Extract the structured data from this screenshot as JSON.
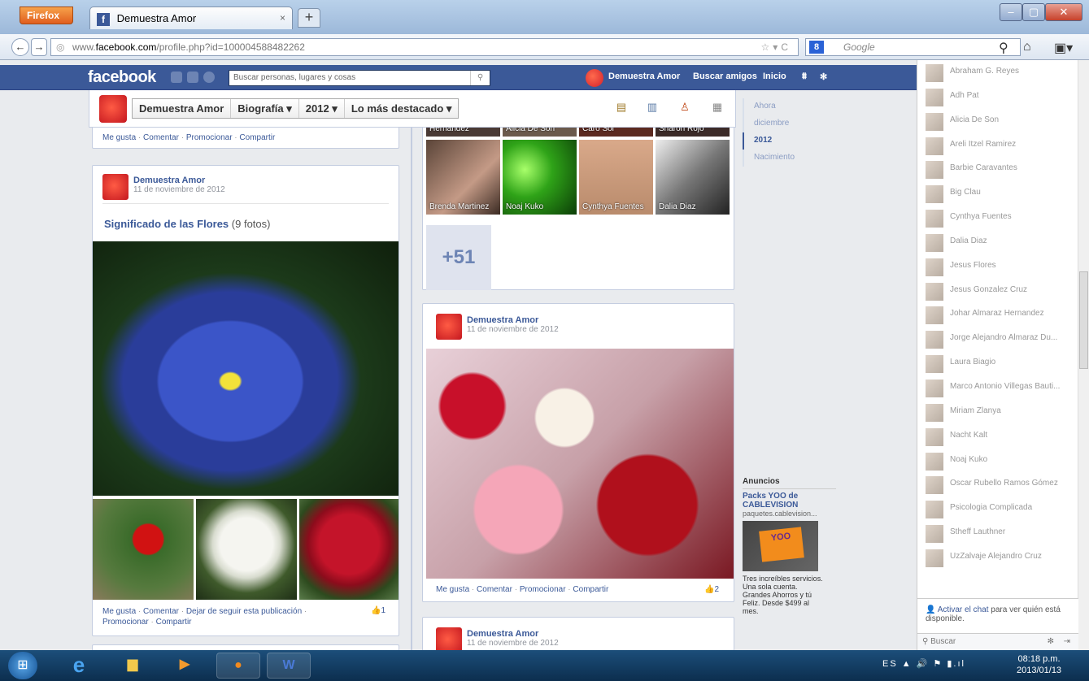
{
  "browser": {
    "menu_label": "Firefox",
    "tab_title": "Demuestra Amor",
    "url_prefix": "www.",
    "url_domain": "facebook.com",
    "url_path": "/profile.php?id=100004588482262",
    "search_engine": "Google"
  },
  "fb": {
    "logo": "facebook",
    "search_placeholder": "Buscar personas, lugares y cosas",
    "user_name": "Demuestra Amor",
    "find_friends": "Buscar amigos",
    "home": "Inicio"
  },
  "cover": {
    "name": "Demuestra Amor",
    "biography": "Biografía ▾",
    "year": "2012 ▾",
    "filter": "Lo más destacado ▾"
  },
  "top_actions": {
    "like": "Me gusta",
    "comment": "Comentar",
    "promote": "Promocionar",
    "share": "Compartir"
  },
  "post1": {
    "author": "Demuestra Amor",
    "date": "11 de noviembre de 2012",
    "album_title": "Significado de las Flores",
    "album_count": "(9 fotos)",
    "like": "Me gusta",
    "comment": "Comentar",
    "unfollow": "Dejar de seguir esta publicación",
    "promote": "Promocionar",
    "share": "Compartir",
    "like_count": "1"
  },
  "friends_grid": {
    "row1": [
      "Johar Almaraz Hernandez",
      "Alicia De Son",
      "Caro Sol",
      "Sharon Rojo"
    ],
    "row2": [
      "Brenda Martinez",
      "Noaj Kuko",
      "Cynthya Fuentes",
      "Dalia Diaz"
    ],
    "more": "+51"
  },
  "post2": {
    "author": "Demuestra Amor",
    "date": "11 de noviembre de 2012",
    "like": "Me gusta",
    "comment": "Comentar",
    "promote": "Promocionar",
    "share": "Compartir",
    "like_count": "2"
  },
  "post3": {
    "author": "Demuestra Amor",
    "date": "11 de noviembre de 2012"
  },
  "scrubber": [
    "Ahora",
    "diciembre",
    "2012",
    "Nacimiento"
  ],
  "ads": {
    "heading": "Anuncios",
    "title": "Packs YOO de CABLEVISION",
    "url": "paquetes.cablevision...",
    "logo_text": "YOO",
    "body": "Tres increíbles servicios. Una sola cuenta. Grandes Ahorros y tú Feliz. Desde $499 al mes."
  },
  "chat": {
    "friends": [
      "Abraham G. Reyes",
      "Adh Pat",
      "Alicia De Son",
      "Areli Itzel Ramirez",
      "Barbie Caravantes",
      "Big Clau",
      "Cynthya Fuentes",
      "Dalia Diaz",
      "Jesus Flores",
      "Jesus Gonzalez Cruz",
      "Johar Almaraz Hernandez",
      "Jorge Alejandro Almaraz Du...",
      "Laura Biagio",
      "Marco Antonio Villegas Bauti...",
      "Miriam Zlanya",
      "Nacht Kalt",
      "Noaj Kuko",
      "Oscar Rubello Ramos Gómez",
      "Psicologia Complicada",
      "Stheff Lauthner",
      "UzZalvaje Alejandro Cruz"
    ],
    "activate_link": "Activar el chat",
    "activate_rest": "para ver quién está disponible.",
    "search_label": "Buscar"
  },
  "taskbar": {
    "lang": "ES",
    "time": "08:18 p.m.",
    "date": "2013/01/13"
  }
}
